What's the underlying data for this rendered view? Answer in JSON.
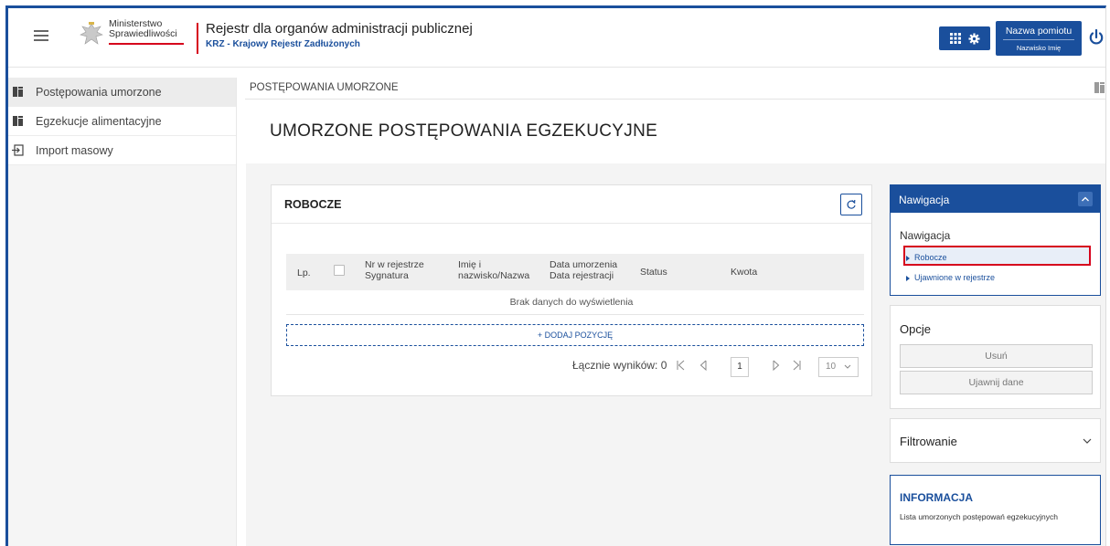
{
  "header": {
    "ministry_line1": "Ministerstwo",
    "ministry_line2": "Sprawiedliwości",
    "app_title": "Rejestr dla organów administracji publicznej",
    "app_subtitle": "KRZ - Krajowy Rejestr Zadłużonych",
    "user_unit": "Nazwa pomiotu",
    "user_name": "Nazwisko Imię",
    "accent_color": "#1a4f9c",
    "brand_red": "#d6001c"
  },
  "sidebar": {
    "items": [
      {
        "label": "Postępowania umorzone",
        "icon": "stamp-icon",
        "active": true
      },
      {
        "label": "Egzekucje alimentacyjne",
        "icon": "stamp-icon",
        "active": false
      },
      {
        "label": "Import masowy",
        "icon": "import-icon",
        "active": false
      }
    ]
  },
  "breadcrumb": "POSTĘPOWANIA UMORZONE",
  "page_title": "UMORZONE POSTĘPOWANIA EGZEKUCYJNE",
  "robocze": {
    "title": "ROBOCZE",
    "columns": {
      "lp": "Lp.",
      "nr_line1": "Nr w rejestrze",
      "nr_line2": "Sygnatura",
      "imie_line1": "Imię i",
      "imie_line2": "nazwisko/Nazwa",
      "data_line1": "Data umorzenia",
      "data_line2": "Data rejestracji",
      "status": "Status",
      "kwota": "Kwota"
    },
    "empty_text": "Brak danych do wyświetlenia",
    "add_label": "+ DODAJ POZYCJĘ",
    "total_label": "Łącznie wyników: 0",
    "page": "1",
    "page_size": "10"
  },
  "navigation": {
    "header": "Nawigacja",
    "subtitle": "Nawigacja",
    "links": [
      "Robocze",
      "Ujawnione w rejestrze"
    ]
  },
  "options": {
    "title": "Opcje",
    "buttons": [
      "Usuń",
      "Ujawnij dane"
    ]
  },
  "filter": {
    "title": "Filtrowanie"
  },
  "info": {
    "title": "INFORMACJA",
    "text": "Lista umorzonych postępowań egzekucyjnych"
  }
}
